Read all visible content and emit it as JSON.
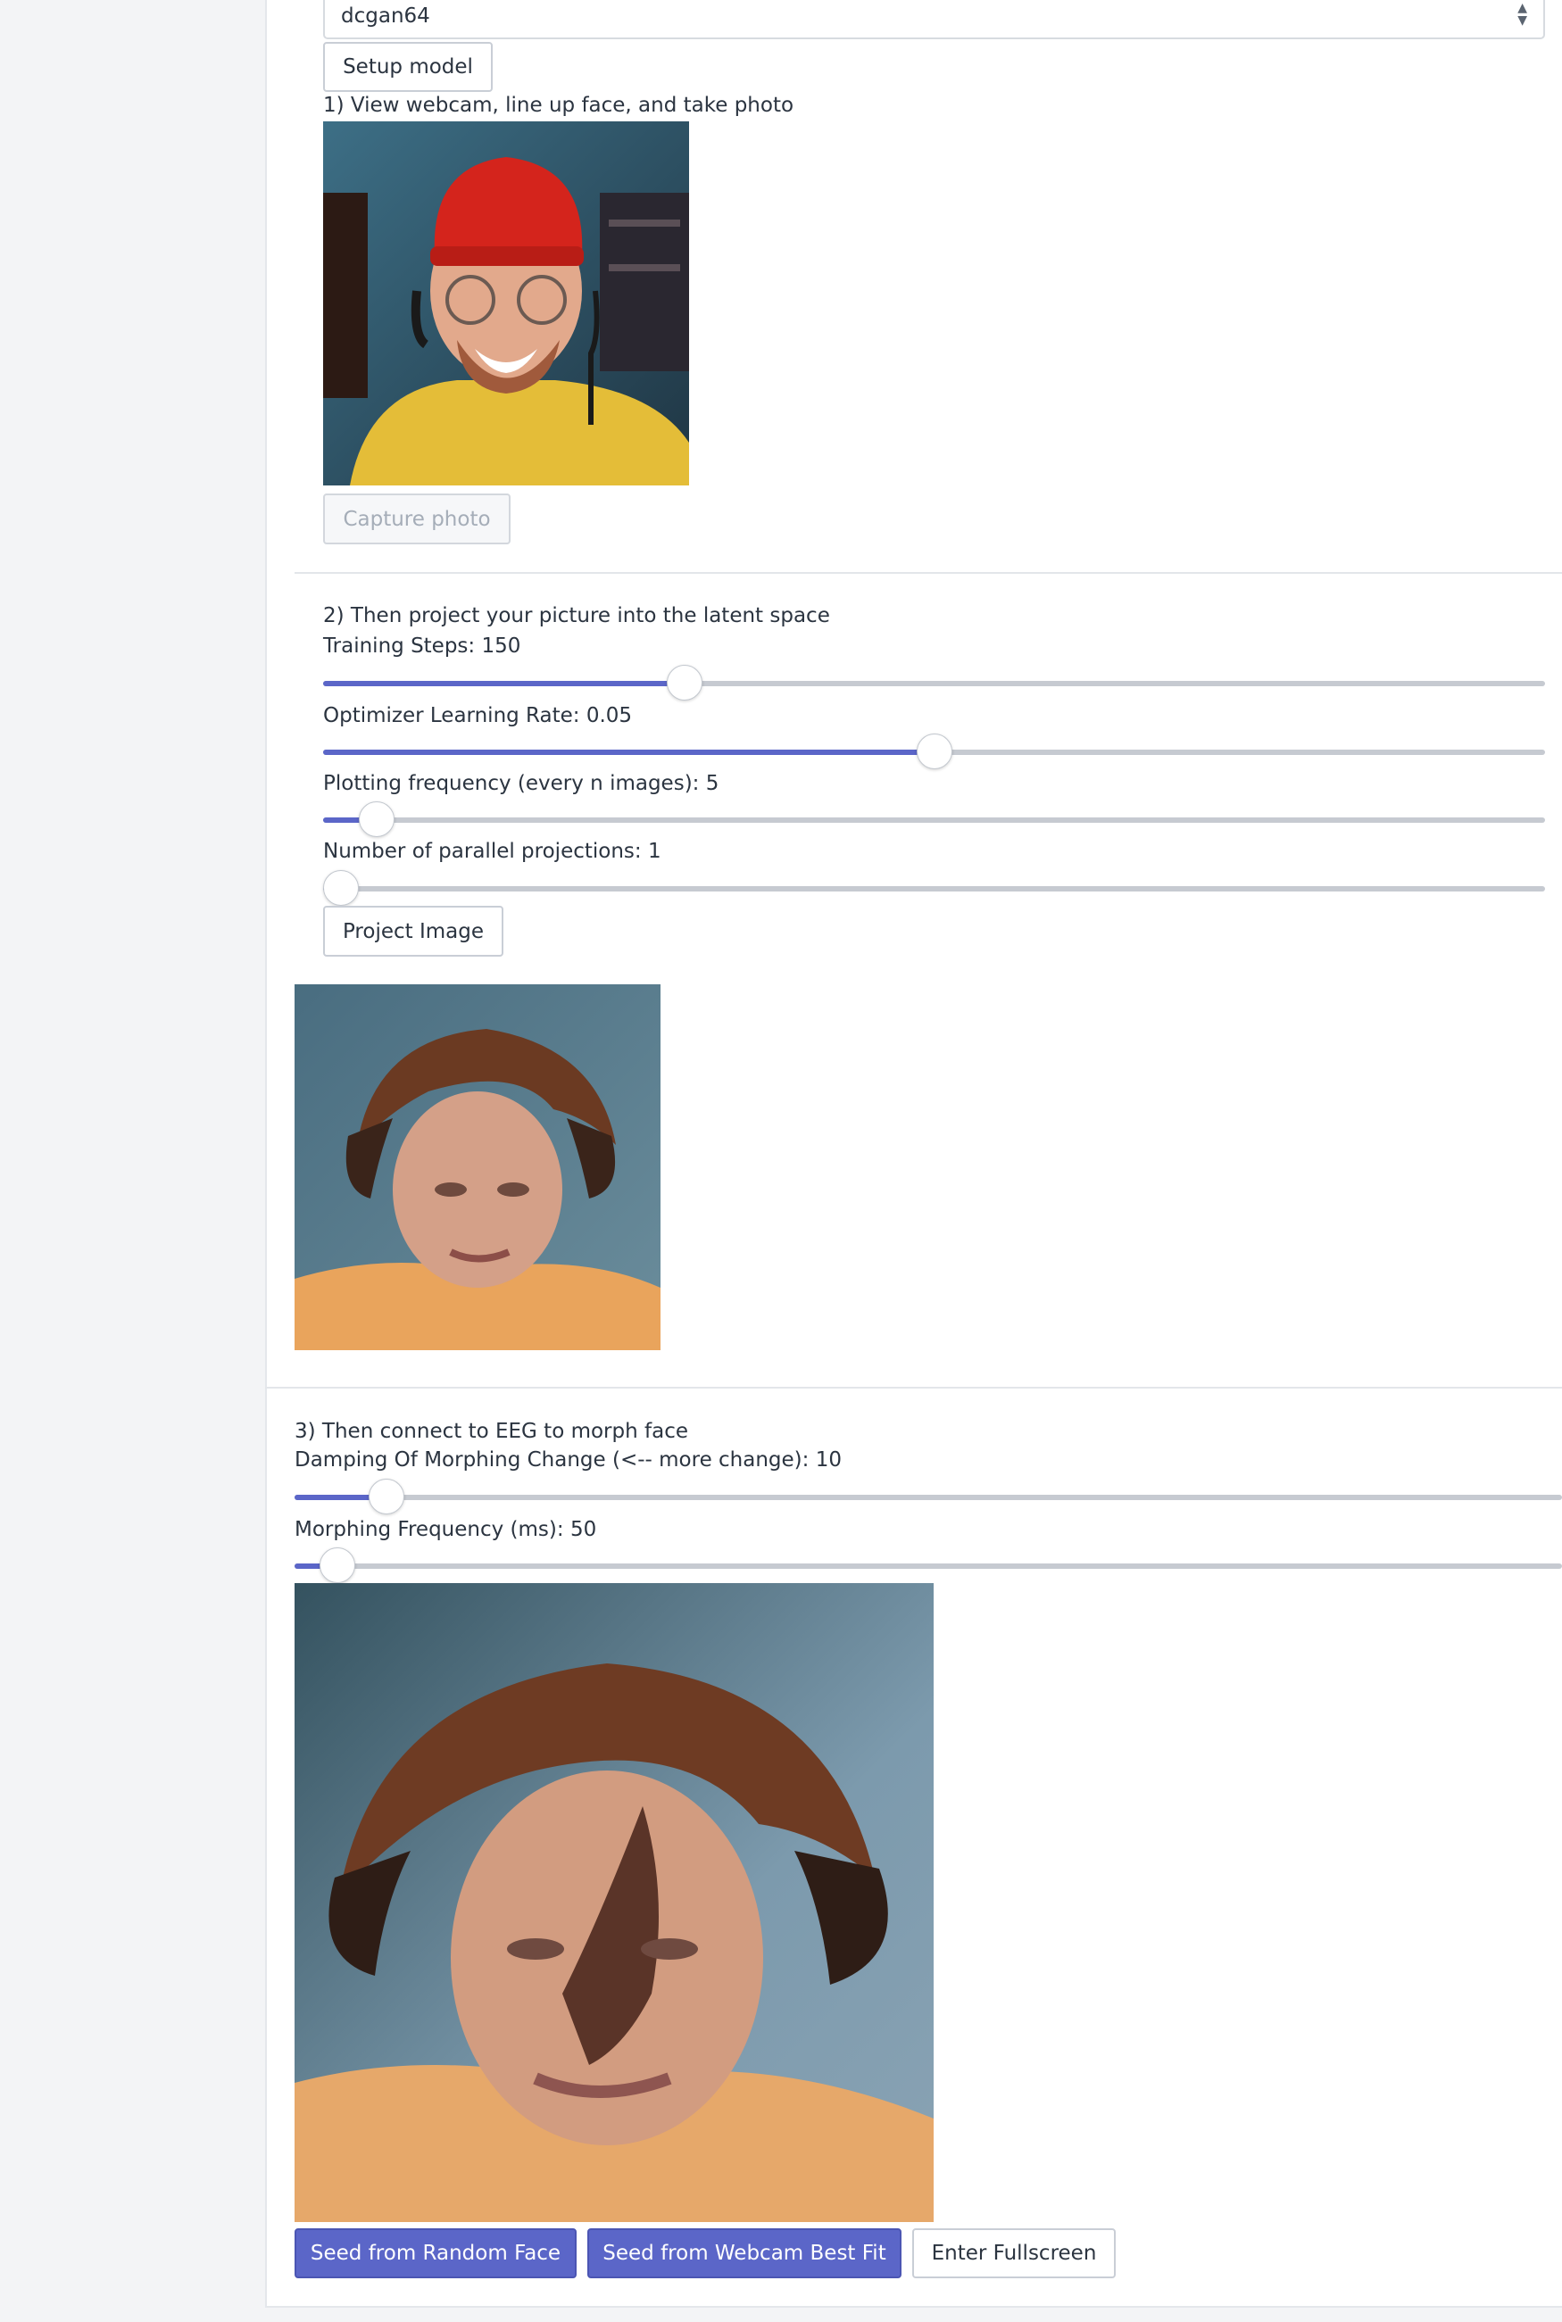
{
  "model_select": {
    "value": "dcgan64"
  },
  "setup_button": "Setup model",
  "step1": {
    "label": "1) View webcam, line up face, and take photo",
    "capture_button": "Capture photo"
  },
  "step2": {
    "label": "2) Then project your picture into the latent space",
    "sliders": [
      {
        "label": "Training Steps: 150",
        "value": 0.29
      },
      {
        "label": "Optimizer Learning Rate: 0.05",
        "value": 0.5
      },
      {
        "label": "Plotting frequency (every n images): 5",
        "value": 0.03
      },
      {
        "label": "Number of parallel projections: 1",
        "value": 0.0
      }
    ],
    "project_button": "Project Image"
  },
  "step3": {
    "label": "3) Then connect to EEG to morph face",
    "sliders": [
      {
        "label": "Damping Of Morphing Change (<-- more change): 10",
        "value": 0.06
      },
      {
        "label": "Morphing Frequency (ms): 50",
        "value": 0.02
      }
    ]
  },
  "buttons": {
    "seed_random": "Seed from Random Face",
    "seed_webcam": "Seed from Webcam Best Fit",
    "fullscreen": "Enter Fullscreen"
  },
  "colors": {
    "accent": "#5b66c8",
    "track": "#c6cad1",
    "divider": "#e3e6ea"
  },
  "icons": {
    "select_arrow": "sort-arrows-icon"
  }
}
